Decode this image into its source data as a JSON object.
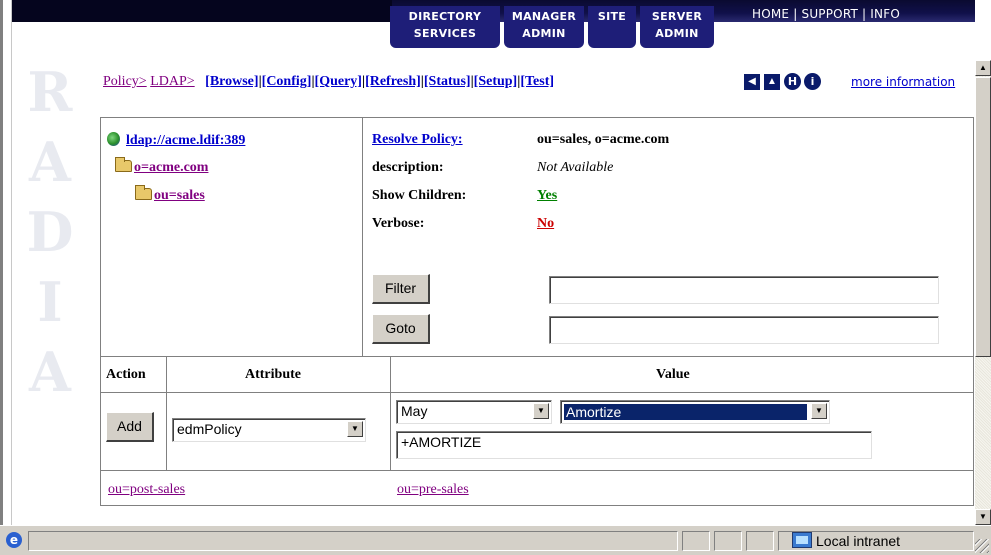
{
  "header": {
    "tabs": [
      {
        "line1": "DIRECTORY",
        "line2": "SERVICES"
      },
      {
        "line1": "MANAGER",
        "line2": "ADMIN"
      },
      {
        "line1": "SITE",
        "line2": ""
      },
      {
        "line1": "SERVER",
        "line2": "ADMIN"
      }
    ],
    "links": {
      "home": "HOME",
      "support": "SUPPORT",
      "info": "INFO",
      "sep": "|"
    }
  },
  "watermark": {
    "letters": [
      "R",
      "A",
      "D",
      "I",
      "A"
    ]
  },
  "breadcrumb": {
    "policy": "Policy>",
    "ldap": "LDAP>",
    "commands": [
      "[Browse]",
      "[Config]",
      "[Query]",
      "[Refresh]",
      "[Status]",
      "[Setup]",
      "[Test]"
    ],
    "sep": "|",
    "more_info": "more information"
  },
  "nav_icons": {
    "prev": "◀",
    "up": "▲",
    "help": "H",
    "info": "i"
  },
  "tree": {
    "root": "ldap://acme.ldif:389",
    "org": "o=acme.com",
    "ou": "ou=sales"
  },
  "properties": {
    "resolve_label": "Resolve Policy:",
    "resolve_value": "ou=sales, o=acme.com",
    "description_label": "description:",
    "description_value": "Not Available",
    "show_children_label": "Show Children:",
    "show_children_value": "Yes",
    "verbose_label": "Verbose:",
    "verbose_value": "No",
    "filter_button": "Filter",
    "goto_button": "Goto",
    "filter_value": "",
    "goto_value": ""
  },
  "attr_table": {
    "headers": {
      "action": "Action",
      "attribute": "Attribute",
      "value": "Value"
    },
    "add_button": "Add",
    "attribute_select": "edmPolicy",
    "value_select_1": "May",
    "value_select_2": "Amortize",
    "value_input": "+AMORTIZE"
  },
  "child_links": [
    "ou=post-sales",
    "ou=pre-sales"
  ],
  "status_bar": {
    "zone": "Local intranet"
  },
  "colors": {
    "nav_blue": "#0a1a6a",
    "visited": "#800080",
    "link": "#0000cc",
    "yes": "#008000",
    "no": "#cc0000",
    "selection": "#0a246a"
  }
}
